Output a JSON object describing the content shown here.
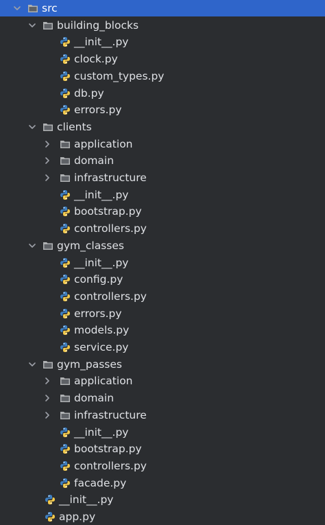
{
  "tree": {
    "rows": [
      {
        "label": "src",
        "kind": "folder",
        "depth": 0,
        "expanded": true,
        "selected": true
      },
      {
        "label": "building_blocks",
        "kind": "folder",
        "depth": 1,
        "expanded": true
      },
      {
        "label": "__init__.py",
        "kind": "py",
        "depth": 2
      },
      {
        "label": "clock.py",
        "kind": "py",
        "depth": 2
      },
      {
        "label": "custom_types.py",
        "kind": "py",
        "depth": 2
      },
      {
        "label": "db.py",
        "kind": "py",
        "depth": 2
      },
      {
        "label": "errors.py",
        "kind": "py",
        "depth": 2
      },
      {
        "label": "clients",
        "kind": "folder",
        "depth": 1,
        "expanded": true
      },
      {
        "label": "application",
        "kind": "folder",
        "depth": 2,
        "expanded": false
      },
      {
        "label": "domain",
        "kind": "folder",
        "depth": 2,
        "expanded": false
      },
      {
        "label": "infrastructure",
        "kind": "folder",
        "depth": 2,
        "expanded": false
      },
      {
        "label": "__init__.py",
        "kind": "py",
        "depth": 2
      },
      {
        "label": "bootstrap.py",
        "kind": "py",
        "depth": 2
      },
      {
        "label": "controllers.py",
        "kind": "py",
        "depth": 2
      },
      {
        "label": "gym_classes",
        "kind": "folder",
        "depth": 1,
        "expanded": true
      },
      {
        "label": "__init__.py",
        "kind": "py",
        "depth": 2
      },
      {
        "label": "config.py",
        "kind": "py",
        "depth": 2
      },
      {
        "label": "controllers.py",
        "kind": "py",
        "depth": 2
      },
      {
        "label": "errors.py",
        "kind": "py",
        "depth": 2
      },
      {
        "label": "models.py",
        "kind": "py",
        "depth": 2
      },
      {
        "label": "service.py",
        "kind": "py",
        "depth": 2
      },
      {
        "label": "gym_passes",
        "kind": "folder",
        "depth": 1,
        "expanded": true
      },
      {
        "label": "application",
        "kind": "folder",
        "depth": 2,
        "expanded": false
      },
      {
        "label": "domain",
        "kind": "folder",
        "depth": 2,
        "expanded": false
      },
      {
        "label": "infrastructure",
        "kind": "folder",
        "depth": 2,
        "expanded": false
      },
      {
        "label": "__init__.py",
        "kind": "py",
        "depth": 2
      },
      {
        "label": "bootstrap.py",
        "kind": "py",
        "depth": 2
      },
      {
        "label": "controllers.py",
        "kind": "py",
        "depth": 2
      },
      {
        "label": "facade.py",
        "kind": "py",
        "depth": 2
      },
      {
        "label": "__init__.py",
        "kind": "py",
        "depth": 1
      },
      {
        "label": "app.py",
        "kind": "py",
        "depth": 1
      }
    ]
  },
  "colors": {
    "background": "#2b2d30",
    "selection": "#2f65ca",
    "text": "#dfe1e5",
    "folder": "#afb1b3",
    "python_blue": "#3e7fc1",
    "python_yellow": "#f2c94c"
  },
  "icons": {
    "folder": "folder-icon",
    "python": "python-file-icon",
    "expanded": "chevron-down-icon",
    "collapsed": "chevron-right-icon"
  }
}
